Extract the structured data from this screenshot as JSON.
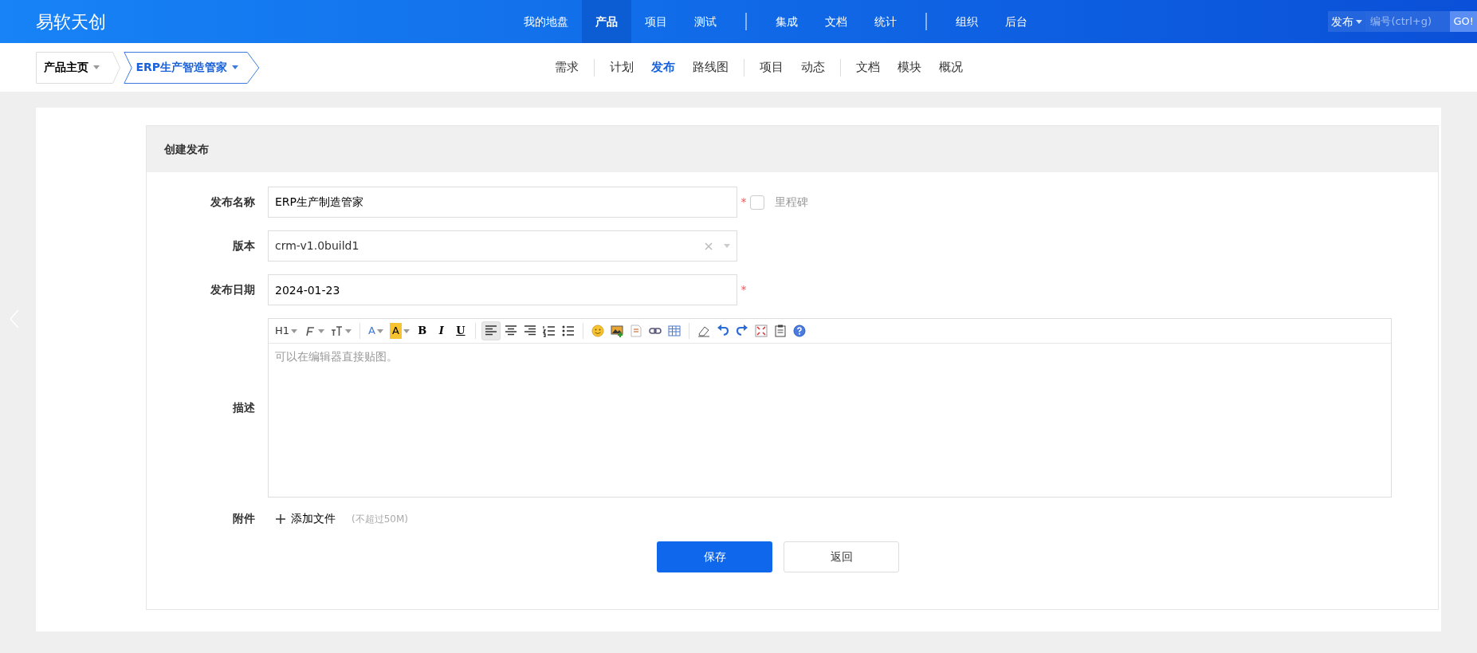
{
  "app": {
    "logo": "易软天创"
  },
  "main_nav": [
    {
      "kind": "link",
      "label": "我的地盘",
      "selected": false
    },
    {
      "kind": "link",
      "label": "产品",
      "selected": true
    },
    {
      "kind": "link",
      "label": "项目",
      "selected": false
    },
    {
      "kind": "link",
      "label": "测试",
      "selected": false
    },
    {
      "kind": "separator"
    },
    {
      "kind": "link",
      "label": "集成",
      "selected": false
    },
    {
      "kind": "link",
      "label": "文档",
      "selected": false
    },
    {
      "kind": "link",
      "label": "统计",
      "selected": false
    },
    {
      "kind": "separator"
    },
    {
      "kind": "link",
      "label": "组织",
      "selected": false
    },
    {
      "kind": "link",
      "label": "后台",
      "selected": false
    }
  ],
  "quick_search": {
    "type": "发布",
    "placeholder": "编号(ctrl+g)",
    "button": "GO!"
  },
  "breadcrumbs": [
    {
      "label": "产品主页",
      "selected": false
    },
    {
      "label": "ERP生产智造管家",
      "selected": true
    }
  ],
  "sub_nav": [
    {
      "kind": "link",
      "label": "需求",
      "selected": false
    },
    {
      "kind": "separator"
    },
    {
      "kind": "link",
      "label": "计划",
      "selected": false
    },
    {
      "kind": "link",
      "label": "发布",
      "selected": true
    },
    {
      "kind": "link",
      "label": "路线图",
      "selected": false
    },
    {
      "kind": "separator"
    },
    {
      "kind": "link",
      "label": "项目",
      "selected": false
    },
    {
      "kind": "link",
      "label": "动态",
      "selected": false
    },
    {
      "kind": "separator"
    },
    {
      "kind": "link",
      "label": "文档",
      "selected": false
    },
    {
      "kind": "link",
      "label": "模块",
      "selected": false
    },
    {
      "kind": "link",
      "label": "概况",
      "selected": false
    }
  ],
  "form": {
    "title": "创建发布",
    "fields": [
      {
        "kind": "text",
        "label": "发布名称",
        "value": "ERP生产制造管家",
        "required_mark": "*",
        "milestone": {
          "label": "里程碑",
          "checked": false
        }
      },
      {
        "kind": "select",
        "label": "版本",
        "value": "crm-v1.0build1"
      },
      {
        "kind": "text",
        "label": "发布日期",
        "value": "2024-01-23",
        "required_mark": "*"
      },
      {
        "kind": "editor",
        "label": "描述",
        "placeholder": "可以在编辑器直接贴图。"
      },
      {
        "kind": "files",
        "label": "附件",
        "action": "添加文件",
        "hint": "(不超过50M)"
      }
    ],
    "toolbar": [
      {
        "kind": "heading",
        "label": "H1",
        "dropdown": true
      },
      {
        "kind": "font",
        "dropdown": true
      },
      {
        "kind": "fontsize",
        "dropdown": true
      },
      {
        "kind": "separator"
      },
      {
        "kind": "forecolor",
        "label": "A",
        "dropdown": true
      },
      {
        "kind": "backcolor",
        "label": "A",
        "dropdown": true
      },
      {
        "kind": "bold",
        "label": "B"
      },
      {
        "kind": "italic",
        "label": "I"
      },
      {
        "kind": "underline",
        "label": "U"
      },
      {
        "kind": "separator"
      },
      {
        "kind": "align-left",
        "selected": true
      },
      {
        "kind": "align-center",
        "selected": false
      },
      {
        "kind": "align-right",
        "selected": false
      },
      {
        "kind": "ordered-list"
      },
      {
        "kind": "unordered-list"
      },
      {
        "kind": "separator"
      },
      {
        "kind": "emoji"
      },
      {
        "kind": "image"
      },
      {
        "kind": "code"
      },
      {
        "kind": "link"
      },
      {
        "kind": "table"
      },
      {
        "kind": "separator"
      },
      {
        "kind": "eraser"
      },
      {
        "kind": "undo"
      },
      {
        "kind": "redo"
      },
      {
        "kind": "fullscreen"
      },
      {
        "kind": "paste"
      },
      {
        "kind": "help"
      }
    ],
    "buttons": [
      {
        "kind": "primary",
        "label": "保存"
      },
      {
        "kind": "secondary",
        "label": "返回"
      }
    ]
  }
}
